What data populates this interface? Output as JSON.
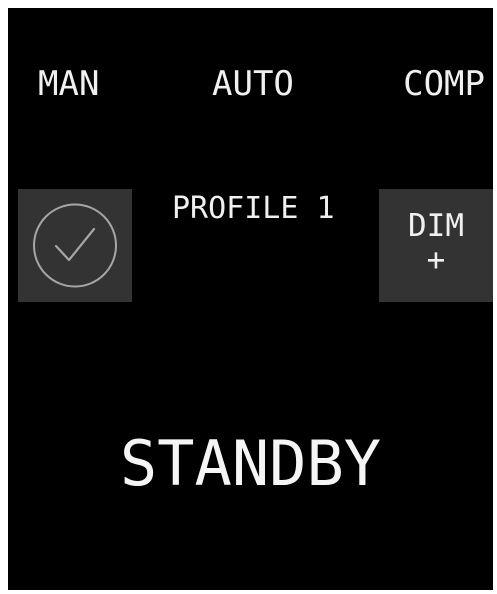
{
  "modes": {
    "man": "MAN",
    "auto": "AUTO",
    "comp": "COMP"
  },
  "confirm_button": {
    "icon": "checkmark-circle-icon"
  },
  "profile": {
    "label": "PROFILE 1"
  },
  "dim_button": {
    "label": "DIM",
    "symbol": "+"
  },
  "status": {
    "text": "STANDBY"
  },
  "colors": {
    "background": "#000000",
    "tile": "#333333",
    "text": "#f0f0f0",
    "icon_stroke": "#a6a6a6"
  }
}
